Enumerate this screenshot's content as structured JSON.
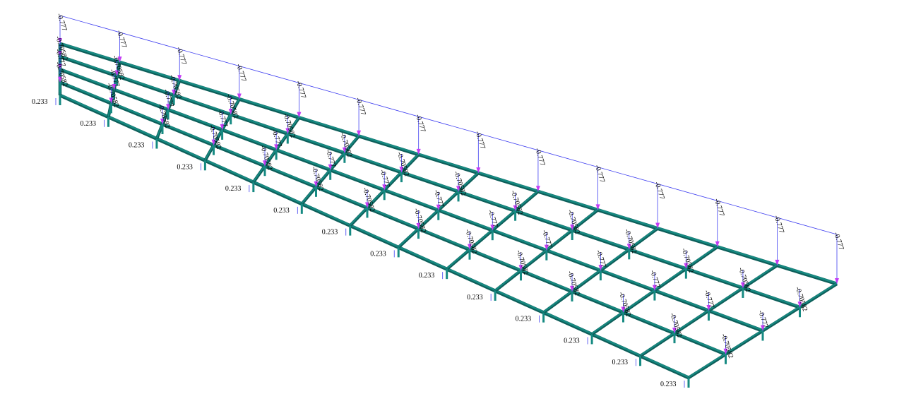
{
  "view": {
    "type": "structural-frame-3d",
    "background": "#ffffff",
    "colors": {
      "member": "#168a82",
      "member_dark": "#0e5f5a",
      "load": "#3d3df0",
      "load_tip": "#c43cf5",
      "label": "#000000"
    }
  },
  "structure": {
    "long_lines": 5,
    "cross_bays": 13
  },
  "loads": {
    "top_edge_value": "-0.777",
    "interior_value": "-0.70582",
    "interior_alt_value": "-0.777",
    "bottom_value": "0.233"
  }
}
